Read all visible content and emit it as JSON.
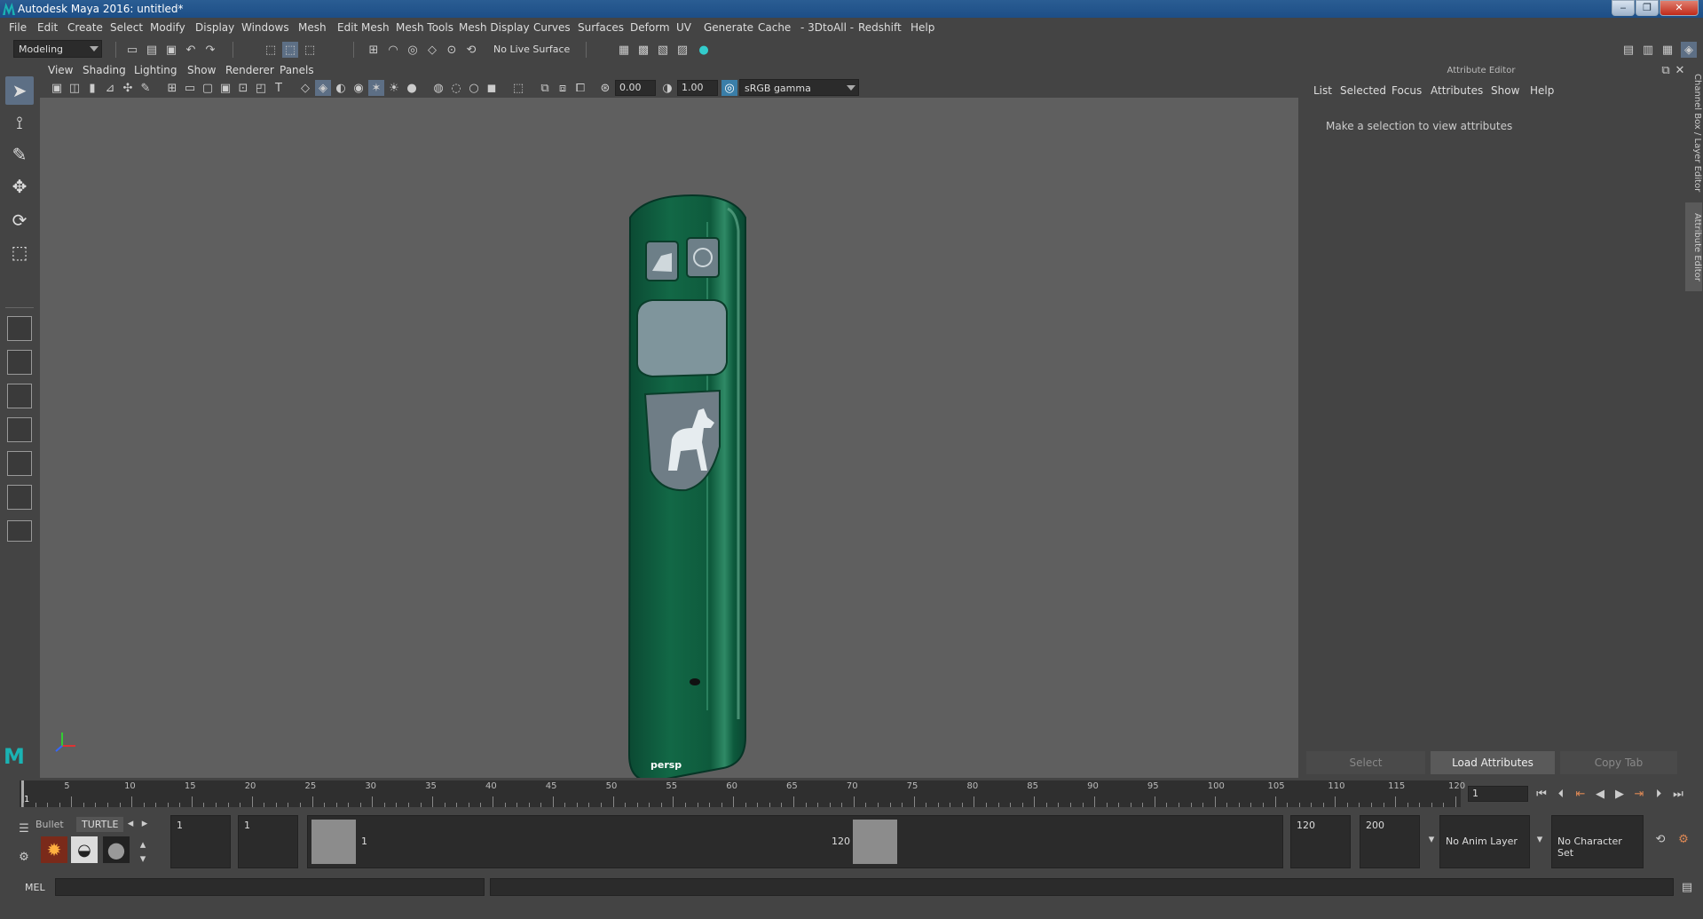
{
  "window": {
    "title": "Autodesk Maya 2016: untitled*",
    "min": "‒",
    "restore": "❐",
    "close": "✕"
  },
  "menubar": {
    "items": [
      "File",
      "Edit",
      "Create",
      "Select",
      "Modify",
      "Display",
      "Windows",
      "Mesh",
      "Edit Mesh",
      "Mesh Tools",
      "Mesh Display",
      "Curves",
      "Surfaces",
      "Deform",
      "UV",
      "Generate",
      "Cache",
      "- 3DtoAll -",
      "Redshift",
      "Help"
    ]
  },
  "statusline": {
    "mode": "Modeling",
    "live_surface": "No Live Surface"
  },
  "panel": {
    "menus": [
      "View",
      "Shading",
      "Lighting",
      "Show",
      "Renderer",
      "Panels"
    ],
    "exposure": "0.00",
    "gamma": "1.00",
    "colorspace": "sRGB gamma",
    "camera": "persp"
  },
  "attribute_editor": {
    "title": "Attribute Editor",
    "menus": [
      "List",
      "Selected",
      "Focus",
      "Attributes",
      "Show",
      "Help"
    ],
    "message": "Make a selection to view attributes",
    "buttons": {
      "select": "Select",
      "load": "Load Attributes",
      "copy": "Copy Tab"
    }
  },
  "side_tabs": {
    "channel_box": "Channel Box / Layer Editor",
    "attribute_editor": "Attribute Editor"
  },
  "timeline": {
    "ticks": [
      "5",
      "10",
      "15",
      "20",
      "25",
      "30",
      "35",
      "40",
      "45",
      "50",
      "55",
      "60",
      "65",
      "70",
      "75",
      "80",
      "85",
      "90",
      "95",
      "100",
      "105",
      "110",
      "115",
      "120"
    ],
    "current_start_label": "1",
    "current_frame": "1"
  },
  "shelf_tabs": {
    "bullet": "Bullet",
    "turtle": "TURTLE"
  },
  "range": {
    "start": "1",
    "playback_start": "1",
    "slider_start": "1",
    "slider_end": "120",
    "playback_end": "120",
    "end": "200",
    "anim_layer": "No Anim Layer",
    "character_set": "No Character Set"
  },
  "command_line": {
    "label": "MEL"
  }
}
